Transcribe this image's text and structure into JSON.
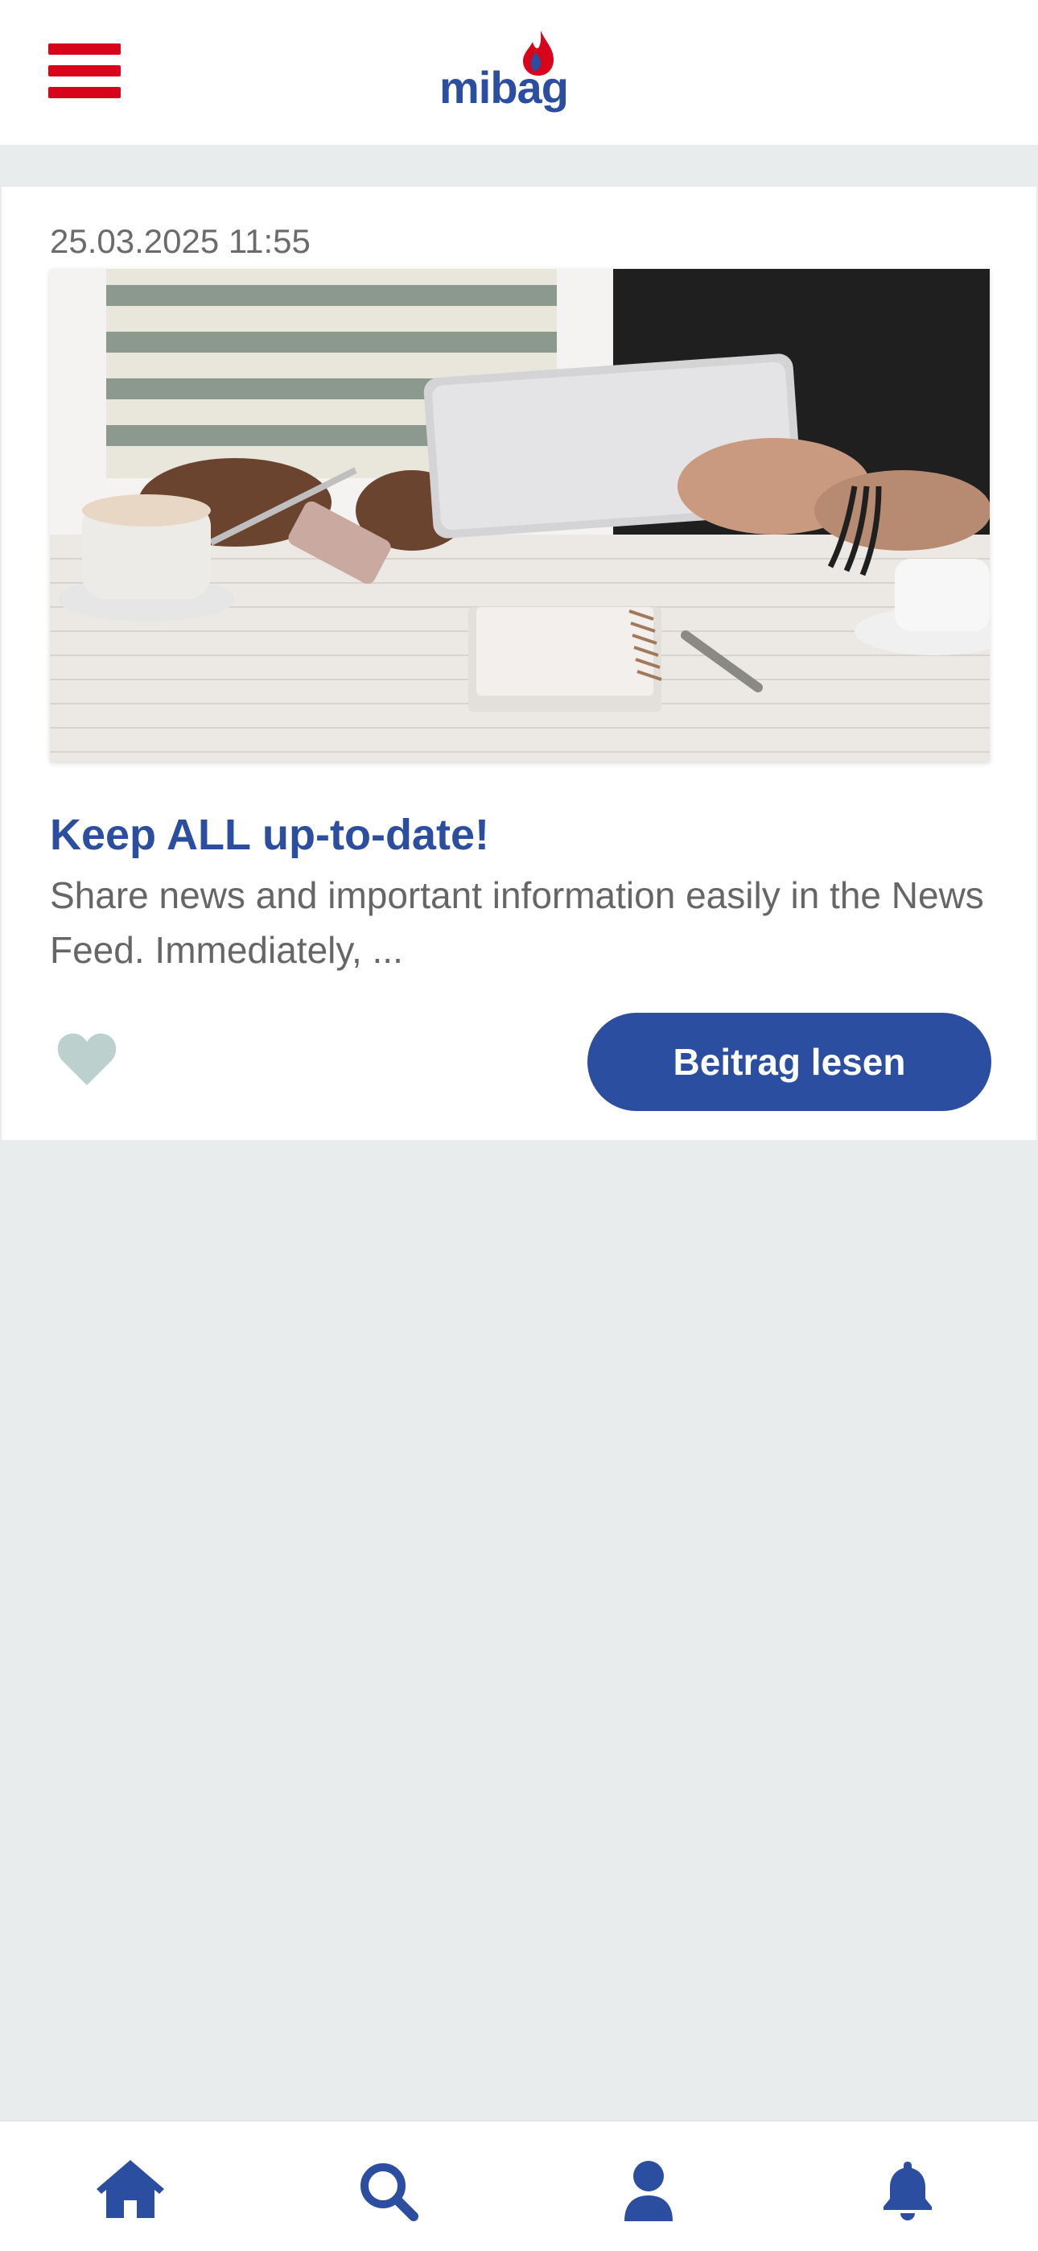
{
  "header": {
    "logo_text": "mibag",
    "menu_icon": "hamburger-menu-icon",
    "brand_color": "#2b4ea0",
    "accent_color": "#d7041b"
  },
  "feed": {
    "posts": [
      {
        "date": "25.03.2025 11:55",
        "title": "Keep ALL up-to-date!",
        "excerpt": "Share news and important information easily in the News Feed. Immediately, ...",
        "like_icon": "heart-icon",
        "read_button_label": "Beitrag lesen"
      }
    ]
  },
  "bottom_nav": {
    "items": [
      {
        "icon": "home-icon"
      },
      {
        "icon": "search-icon"
      },
      {
        "icon": "user-icon"
      },
      {
        "icon": "bell-icon"
      }
    ]
  }
}
